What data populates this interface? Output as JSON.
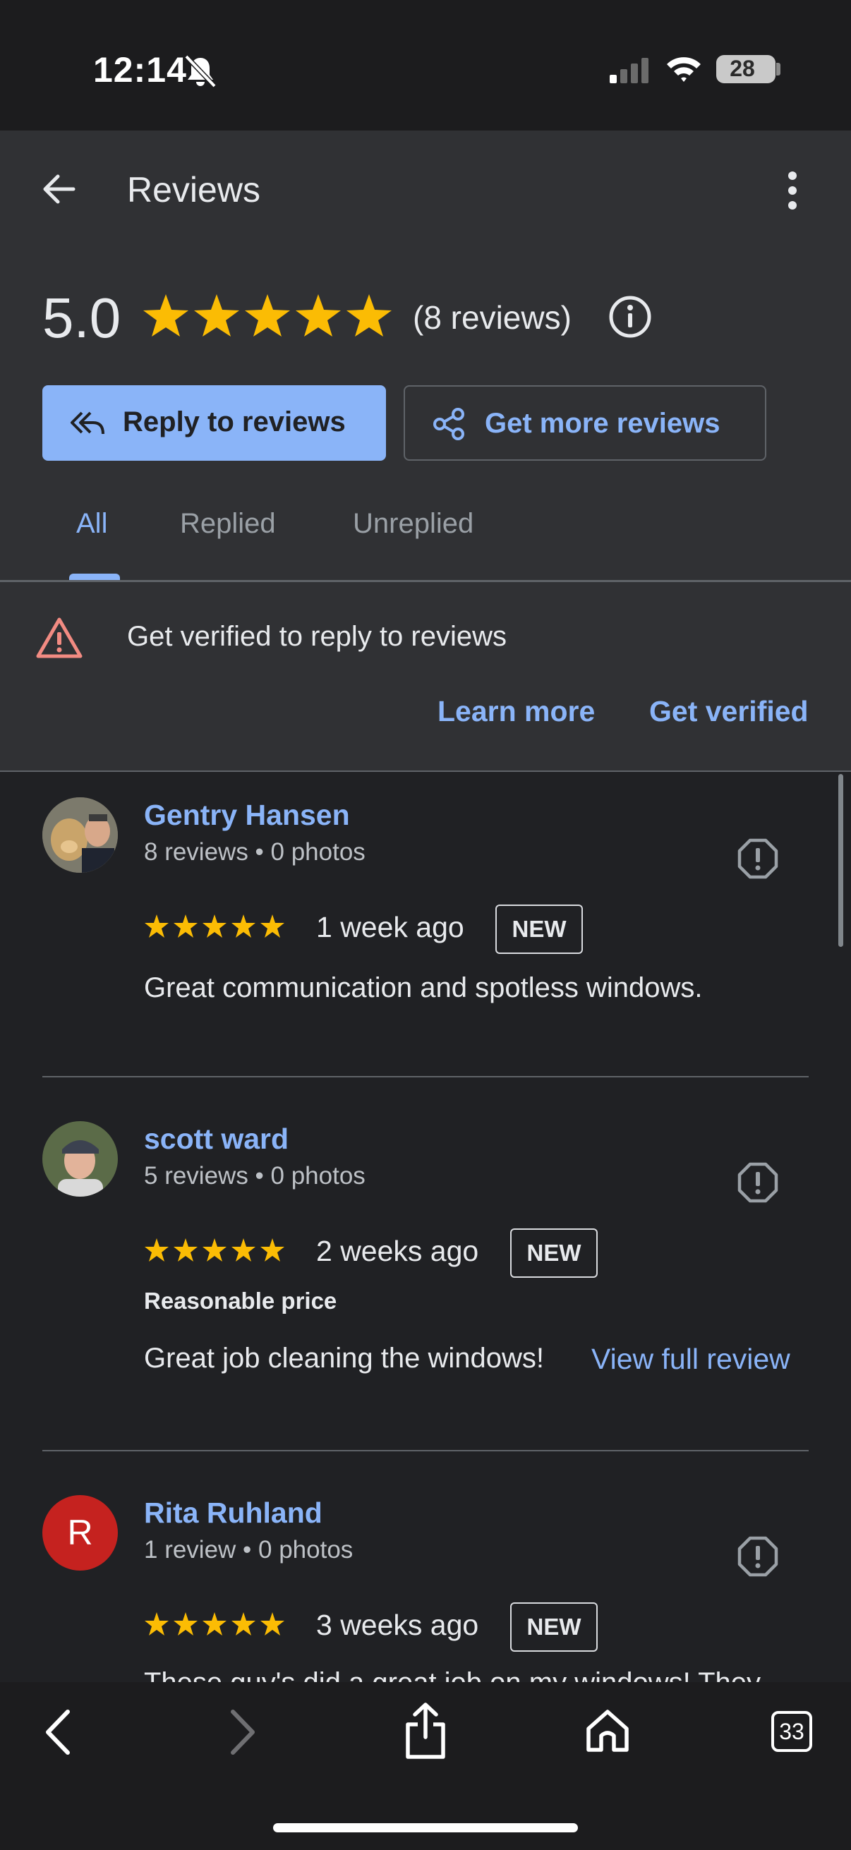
{
  "status_bar": {
    "time": "12:14",
    "battery": "28"
  },
  "header": {
    "title": "Reviews"
  },
  "summary": {
    "rating": "5.0",
    "stars": 5,
    "count_text": "(8 reviews)"
  },
  "actions": {
    "reply_label": "Reply to reviews",
    "more_label": "Get more reviews"
  },
  "tabs": [
    {
      "label": "All",
      "selected": true
    },
    {
      "label": "Replied",
      "selected": false
    },
    {
      "label": "Unreplied",
      "selected": false
    }
  ],
  "banner": {
    "text": "Get verified to reply to reviews",
    "learn_more": "Learn more",
    "get_verified": "Get verified"
  },
  "reviews": [
    {
      "name": "Gentry Hansen",
      "meta": "8 reviews • 0 photos",
      "stars": 5,
      "time": "1 week ago",
      "badge": "NEW",
      "attribute": "",
      "body": "Great communication and spotless windows.",
      "link": ""
    },
    {
      "name": "scott ward",
      "meta": "5 reviews • 0 photos",
      "stars": 5,
      "time": "2 weeks ago",
      "badge": "NEW",
      "attribute": "Reasonable price",
      "body": "Great job cleaning the windows!",
      "link": "View full review"
    },
    {
      "name": "Rita Ruhland",
      "initial": "R",
      "meta": "1 review • 0 photos",
      "stars": 5,
      "time": "3 weeks ago",
      "badge": "NEW",
      "attribute": "",
      "body": "These guy's did a great job on my windows! They",
      "link": ""
    }
  ],
  "browser_bar": {
    "tabs_count": "33"
  },
  "colors": {
    "accent": "#8ab4f8",
    "star": "#fbbc04",
    "warning": "#f28b82",
    "avatar_r": "#c5221f"
  }
}
